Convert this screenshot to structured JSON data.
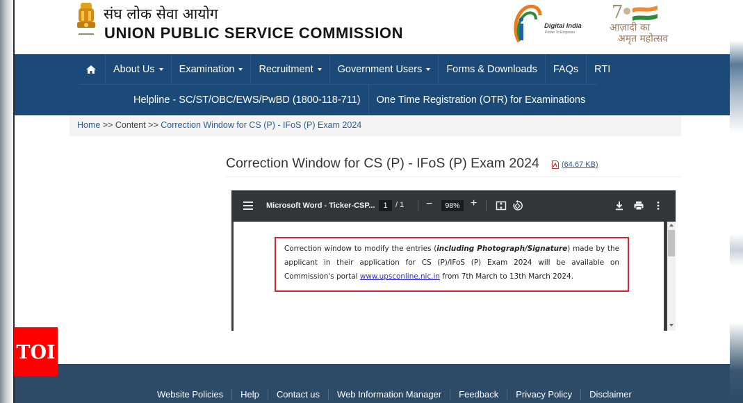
{
  "header": {
    "title_hindi": "संघ लोक सेवा आयोग",
    "title_english": "UNION PUBLIC SERVICE COMMISSION",
    "digital_india": {
      "name": "Digital India",
      "tagline": "Power To Empower"
    },
    "azadi": {
      "line1": "आज़ादी का",
      "line2": "अमृत महोत्सव",
      "number": "75"
    }
  },
  "nav": {
    "row1": [
      {
        "label": "",
        "icon": "home-icon"
      },
      {
        "label": "About Us",
        "dropdown": true
      },
      {
        "label": "Examination",
        "dropdown": true
      },
      {
        "label": "Recruitment",
        "dropdown": true
      },
      {
        "label": "Government Users",
        "dropdown": true
      },
      {
        "label": "Forms & Downloads",
        "dropdown": false
      },
      {
        "label": "FAQs",
        "dropdown": false
      },
      {
        "label": "RTI",
        "dropdown": false
      }
    ],
    "row2": [
      {
        "label": "Helpline - SC/ST/OBC/EWS/PwBD (1800-118-711)"
      },
      {
        "label": "One Time Registration (OTR) for Examinations"
      }
    ]
  },
  "breadcrumb": {
    "items": [
      "Home",
      "Content",
      "Correction Window for CS (P) - IFoS (P) Exam 2024"
    ],
    "separator": ">>"
  },
  "content": {
    "title": "Correction Window for CS (P) - IFoS (P) Exam 2024",
    "file_size": "(64.67 KB)"
  },
  "pdf_viewer": {
    "document_title": "Microsoft Word - Ticker-CSP...",
    "current_page": "1",
    "page_count": "/  1",
    "zoom": "98%",
    "notice": {
      "part1": "Correction window to modify the entries (",
      "bold_italic": "including Photograph/Signature",
      "part2": ") made by the applicant in their application for CS (P)/IFoS (P)  Exam 2024 will be available on Commission's portal ",
      "link": "www.upsconline.nic.in",
      "part3": " from 7th March to 13th March 2024."
    }
  },
  "badge": {
    "text": "TOI"
  },
  "footer": {
    "links": [
      "Website Policies",
      "Help",
      "Contact us",
      "Web Information Manager",
      "Feedback",
      "Privacy Policy",
      "Disclaimer"
    ]
  },
  "colors": {
    "nav_bg": "#1b4a78",
    "footer_bg": "#2d4a66",
    "notice_border": "#d9232e",
    "toi_red": "#ff0000",
    "link": "#2a5d94"
  }
}
